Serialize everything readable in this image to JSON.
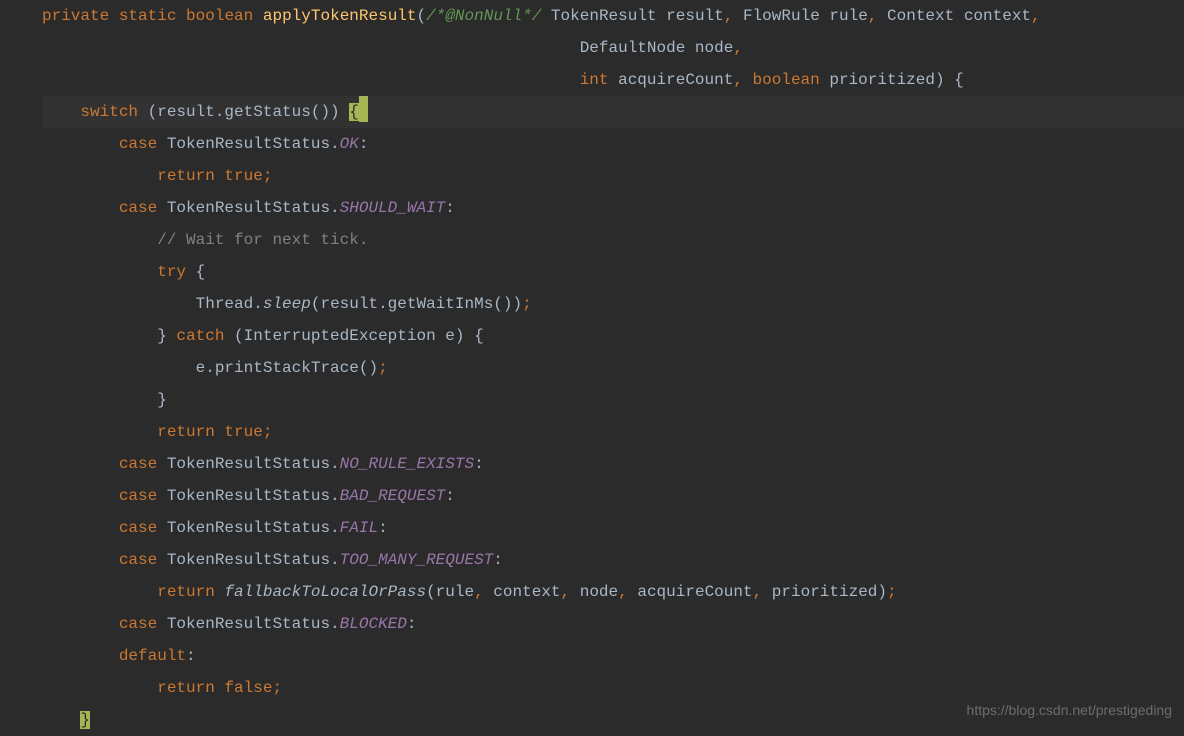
{
  "code": {
    "line1_kw1": "private",
    "line1_kw2": "static",
    "line1_kw3": "boolean",
    "line1_method": "applyTokenResult",
    "line1_paren": "(",
    "line1_comment": "/*@NonNull*/",
    "line1_type1": " TokenResult result",
    "line1_comma1": ",",
    "line1_type2": " FlowRule rule",
    "line1_comma2": ",",
    "line1_type3": " Context context",
    "line1_comma3": ",",
    "line2_type": "DefaultNode node",
    "line2_comma": ",",
    "line3_kw1": "int",
    "line3_id1": " acquireCount",
    "line3_comma": ",",
    "line3_kw2": " boolean",
    "line3_id2": " prioritized) {",
    "line4_kw": "switch",
    "line4_rest": " (result.getStatus()) ",
    "line4_brace": "{",
    "line5_kw": "case",
    "line5_type": " TokenResultStatus.",
    "line5_field": "OK",
    "line5_colon": ":",
    "line6_kw": "return true",
    "line6_semi": ";",
    "line7_kw": "case",
    "line7_type": " TokenResultStatus.",
    "line7_field": "SHOULD_WAIT",
    "line7_colon": ":",
    "line8_comment": "// Wait for next tick.",
    "line9_kw": "try",
    "line9_brace": " {",
    "line10_thread": "Thread.",
    "line10_sleep": "sleep",
    "line10_rest": "(result.getWaitInMs())",
    "line10_semi": ";",
    "line11_close": "} ",
    "line11_kw": "catch",
    "line11_rest": " (InterruptedException e) {",
    "line12_rest": "e.printStackTrace()",
    "line12_semi": ";",
    "line13_close": "}",
    "line14_kw": "return true",
    "line14_semi": ";",
    "line15_kw": "case",
    "line15_type": " TokenResultStatus.",
    "line15_field": "NO_RULE_EXISTS",
    "line15_colon": ":",
    "line16_kw": "case",
    "line16_type": " TokenResultStatus.",
    "line16_field": "BAD_REQUEST",
    "line16_colon": ":",
    "line17_kw": "case",
    "line17_type": " TokenResultStatus.",
    "line17_field": "FAIL",
    "line17_colon": ":",
    "line18_kw": "case",
    "line18_type": " TokenResultStatus.",
    "line18_field": "TOO_MANY_REQUEST",
    "line18_colon": ":",
    "line19_kw": "return ",
    "line19_method": "fallbackToLocalOrPass",
    "line19_p1": "(rule",
    "line19_c1": ",",
    "line19_p2": " context",
    "line19_c2": ",",
    "line19_p3": " node",
    "line19_c3": ",",
    "line19_p4": " acquireCount",
    "line19_c4": ",",
    "line19_p5": " prioritized)",
    "line19_semi": ";",
    "line20_kw": "case",
    "line20_type": " TokenResultStatus.",
    "line20_field": "BLOCKED",
    "line20_colon": ":",
    "line21_kw": "default",
    "line21_colon": ":",
    "line22_kw": "return false",
    "line22_semi": ";",
    "line23_brace": "}"
  },
  "watermark": "https://blog.csdn.net/prestigeding"
}
